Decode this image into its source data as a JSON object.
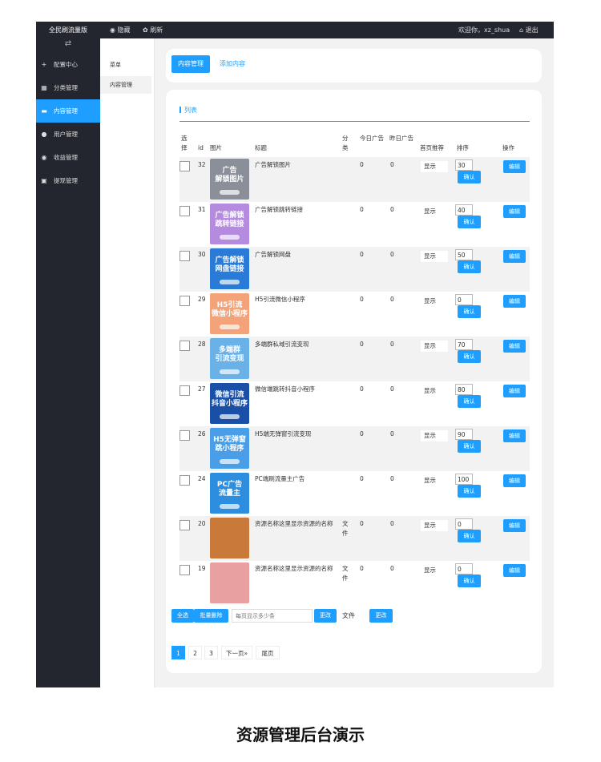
{
  "app": {
    "brand": "全民刷流量版"
  },
  "topbar": {
    "hide": "隐藏",
    "refresh": "刷新",
    "welcome": "欢迎你，xz_shua",
    "logout": "退出"
  },
  "sidebar": {
    "toggle": "⇄",
    "items": [
      {
        "icon": "+",
        "label": "配置中心"
      },
      {
        "icon": "▦",
        "label": "分类管理"
      },
      {
        "icon": "▬",
        "label": "内容管理"
      },
      {
        "icon": "●",
        "label": "用户管理"
      },
      {
        "icon": "◉",
        "label": "收益管理"
      },
      {
        "icon": "▣",
        "label": "提现管理"
      }
    ]
  },
  "subsidebar": {
    "head": "菜单",
    "item": "内容管理"
  },
  "tabs": {
    "active": "内容管理",
    "add": "添加内容"
  },
  "list": {
    "title": "列表",
    "headers": {
      "select": "选择",
      "id": "id",
      "image": "图片",
      "title": "标题",
      "category": "分类",
      "today": "今日广告",
      "yesterday": "昨日广告",
      "home": "首页推荐",
      "sort": "排序",
      "action": "操作"
    },
    "rows": [
      {
        "id": "32",
        "title": "广告解锁图片",
        "cat": "",
        "today": "0",
        "yday": "0",
        "home": "显示",
        "sort": "30",
        "thumb": "广告\n解锁图片",
        "bg": "#8a8f99"
      },
      {
        "id": "31",
        "title": "广告解锁跳转链接",
        "cat": "",
        "today": "0",
        "yday": "0",
        "home": "显示",
        "sort": "40",
        "thumb": "广告解锁\n跳转链接",
        "bg": "#b58be0"
      },
      {
        "id": "30",
        "title": "广告解锁网盘",
        "cat": "",
        "today": "0",
        "yday": "0",
        "home": "显示",
        "sort": "50",
        "thumb": "广告解锁\n网盘链接",
        "bg": "#2a7bd8"
      },
      {
        "id": "29",
        "title": "H5引流微信小程序",
        "cat": "",
        "today": "0",
        "yday": "0",
        "home": "显示",
        "sort": "0",
        "thumb": "H5引流\n微信小程序",
        "bg": "#f4a27a"
      },
      {
        "id": "28",
        "title": "多端群私域引流变现",
        "cat": "",
        "today": "0",
        "yday": "0",
        "home": "显示",
        "sort": "70",
        "thumb": "多端群\n引流变现",
        "bg": "#6ab1e8"
      },
      {
        "id": "27",
        "title": "微信端跳转抖音小程序",
        "cat": "",
        "today": "0",
        "yday": "0",
        "home": "显示",
        "sort": "80",
        "thumb": "微信引流\n抖音小程序",
        "bg": "#1a4fa8"
      },
      {
        "id": "26",
        "title": "H5端无弹窗引流变现",
        "cat": "",
        "today": "0",
        "yday": "0",
        "home": "显示",
        "sort": "90",
        "thumb": "H5无弹窗\n跳小程序",
        "bg": "#4a9ee8"
      },
      {
        "id": "24",
        "title": "PC端刷流量主广告",
        "cat": "",
        "today": "0",
        "yday": "0",
        "home": "显示",
        "sort": "100",
        "thumb": "PC广告\n流量主",
        "bg": "#2d8ee0"
      },
      {
        "id": "20",
        "title": "资源名称这里显示资源的名称",
        "cat": "文件",
        "today": "0",
        "yday": "0",
        "home": "显示",
        "sort": "0",
        "thumb": "",
        "bg": "#c97a3a"
      },
      {
        "id": "19",
        "title": "资源名称这里显示资源的名称",
        "cat": "文件",
        "today": "0",
        "yday": "0",
        "home": "显示",
        "sort": "0",
        "thumb": "",
        "bg": "#e8a0a0"
      }
    ],
    "confirm_label": "确认",
    "edit_label": "编辑"
  },
  "footer": {
    "select_all": "全选",
    "batch_delete": "批量删除",
    "per_page_placeholder": "每页显示多少条",
    "change1": "更改",
    "file_label": "文件",
    "change2": "更改"
  },
  "pager": {
    "pages": [
      "1",
      "2",
      "3"
    ],
    "next": "下一页»",
    "last": "尾页"
  },
  "caption": "资源管理后台演示"
}
